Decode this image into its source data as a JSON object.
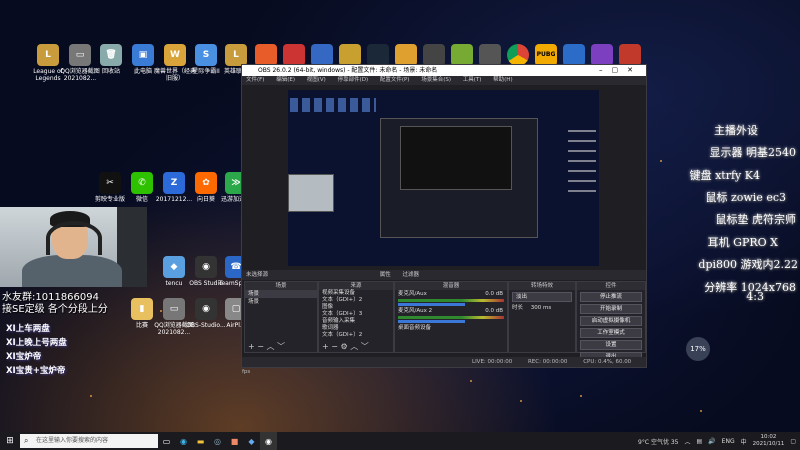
{
  "desktop": {
    "icons_row1": [
      {
        "label": "League of Legends",
        "color": "#c89b3c",
        "glyph": "L"
      },
      {
        "label": "QQ浏览器截图2021082...",
        "color": "#777",
        "glyph": "▭"
      },
      {
        "label": "回收站",
        "color": "#8aa",
        "glyph": "🗑"
      },
      {
        "label": "此电脑",
        "color": "#3a7bd5",
        "glyph": "▣"
      },
      {
        "label": "魔兽世界（经典旧服）",
        "color": "#d9a43a",
        "glyph": "W"
      },
      {
        "label": "星际争霸II",
        "color": "#4a90e2",
        "glyph": "S"
      },
      {
        "label": "英雄联盟",
        "color": "#c89b3c",
        "glyph": "L"
      }
    ],
    "icons_row2": [
      {
        "label": "剪映专业版",
        "color": "#111",
        "glyph": "✂"
      },
      {
        "label": "微信",
        "color": "#2dc100",
        "glyph": "✆"
      },
      {
        "label": "20171212...",
        "color": "#2b6ad8",
        "glyph": "Z"
      },
      {
        "label": "向日葵",
        "color": "#ff6a00",
        "glyph": "✿"
      },
      {
        "label": "迅游加速器",
        "color": "#2aa84a",
        "glyph": "≫"
      }
    ],
    "icons_row3": [
      {
        "label": "tencu",
        "color": "#5aa0e0",
        "glyph": "◆"
      },
      {
        "label": "OBS Studio",
        "color": "#333",
        "glyph": "◉"
      },
      {
        "label": "TeamSpeak",
        "color": "#2b67c7",
        "glyph": "☎"
      }
    ],
    "icons_row4": [
      {
        "label": "比赛",
        "color": "#e8c060",
        "glyph": "▮"
      },
      {
        "label": "QQ浏览器截图2021082...",
        "color": "#777",
        "glyph": "▭"
      },
      {
        "label": "OBS-Studio...",
        "color": "#333",
        "glyph": "◉"
      },
      {
        "label": "AirPl...",
        "color": "#888",
        "glyph": "▢"
      }
    ]
  },
  "overlay": {
    "qq_group": "水友群:1011866094",
    "rank_note": "接SE定级  各个分段上分",
    "notes": [
      "XI上车两盘",
      "XI上晚上号两盘",
      "XI宝炉帝",
      "XI宝贵+宝炉帝"
    ],
    "specs": [
      "主播外设",
      "显示器 明基2540",
      "键盘 xtrfy K4",
      "鼠标 zowie ec3",
      "鼠标垫 虎符宗师",
      "耳机 GPRO X",
      "dpi800 游戏内2.22",
      "分辨率 1024x768",
      "4:3"
    ]
  },
  "obs": {
    "title": "OBS 26.0.2 (64-bit, windows) - 配置文件: 未命名 - 场景: 未命名",
    "menu": [
      "文件(F)",
      "编辑(E)",
      "视图(V)",
      "停靠部件(D)",
      "配置文件(P)",
      "场景集合(S)",
      "工具(T)",
      "帮助(H)"
    ],
    "bar": [
      "未选择源",
      "属性",
      "过滤器"
    ],
    "docks": {
      "scenes": {
        "header": "场景",
        "items": [
          "场景",
          "场景"
        ]
      },
      "sources": {
        "header": "来源",
        "items": [
          "视频采集设备",
          "文本（GDI+）2",
          "图像",
          "文本（GDI+）3",
          "音频输入采集",
          "歌词器",
          "文本（GDI+）2"
        ]
      },
      "mixer": {
        "header": "混音器",
        "items": [
          "麦克风/Aux",
          "0.0 dB",
          "麦克风/Aux 2",
          "0.0 dB",
          "桌面音频设备"
        ]
      },
      "transitions": {
        "header": "转场特效",
        "type": "淡出",
        "duration_label": "时长",
        "duration": "300 ms"
      },
      "controls": {
        "header": "控件",
        "buttons": [
          "停止推流",
          "开始录制",
          "启动虚拟摄像机",
          "工作室模式",
          "设置",
          "退出"
        ]
      }
    },
    "status": [
      "LIVE: 00:00:00",
      "REC: 00:00:00",
      "CPU: 0.4%, 60.00 fps"
    ]
  },
  "weather_badge": "17%",
  "taskbar": {
    "search_placeholder": "在这里输入你要搜索的内容",
    "tray": {
      "weather": "9°C 空气优 35",
      "lang": "ENG",
      "time": "10:02",
      "date": "2021/10/11"
    }
  }
}
